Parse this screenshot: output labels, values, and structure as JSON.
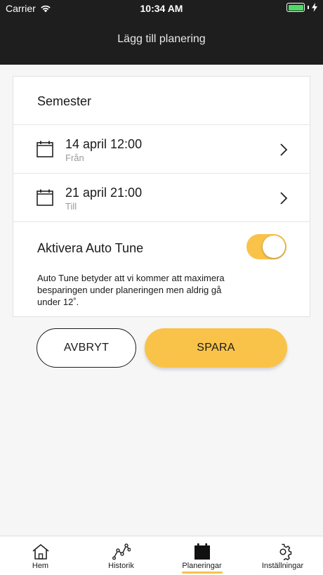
{
  "status": {
    "carrier": "Carrier",
    "time": "10:34 AM"
  },
  "nav": {
    "title": "Lägg till planering"
  },
  "form": {
    "name": "Semester",
    "from": {
      "date": "14 april 12:00",
      "label": "Från"
    },
    "to": {
      "date": "21 april 21:00",
      "label": "Till"
    },
    "auto_tune": {
      "label": "Aktivera Auto Tune",
      "enabled": true,
      "description": "Auto Tune betyder att vi kommer att maximera besparingen under planeringen men aldrig gå under 12˚."
    }
  },
  "buttons": {
    "cancel": "AVBRYT",
    "save": "SPARA"
  },
  "tabs": [
    {
      "label": "Hem",
      "icon": "home-icon"
    },
    {
      "label": "Historik",
      "icon": "history-icon"
    },
    {
      "label": "Planeringar",
      "icon": "calendar-icon",
      "active": true
    },
    {
      "label": "Inställningar",
      "icon": "gear-icon"
    }
  ],
  "colors": {
    "accent": "#f9c34a",
    "header": "#1e1e1e",
    "battery": "#4cd964"
  }
}
